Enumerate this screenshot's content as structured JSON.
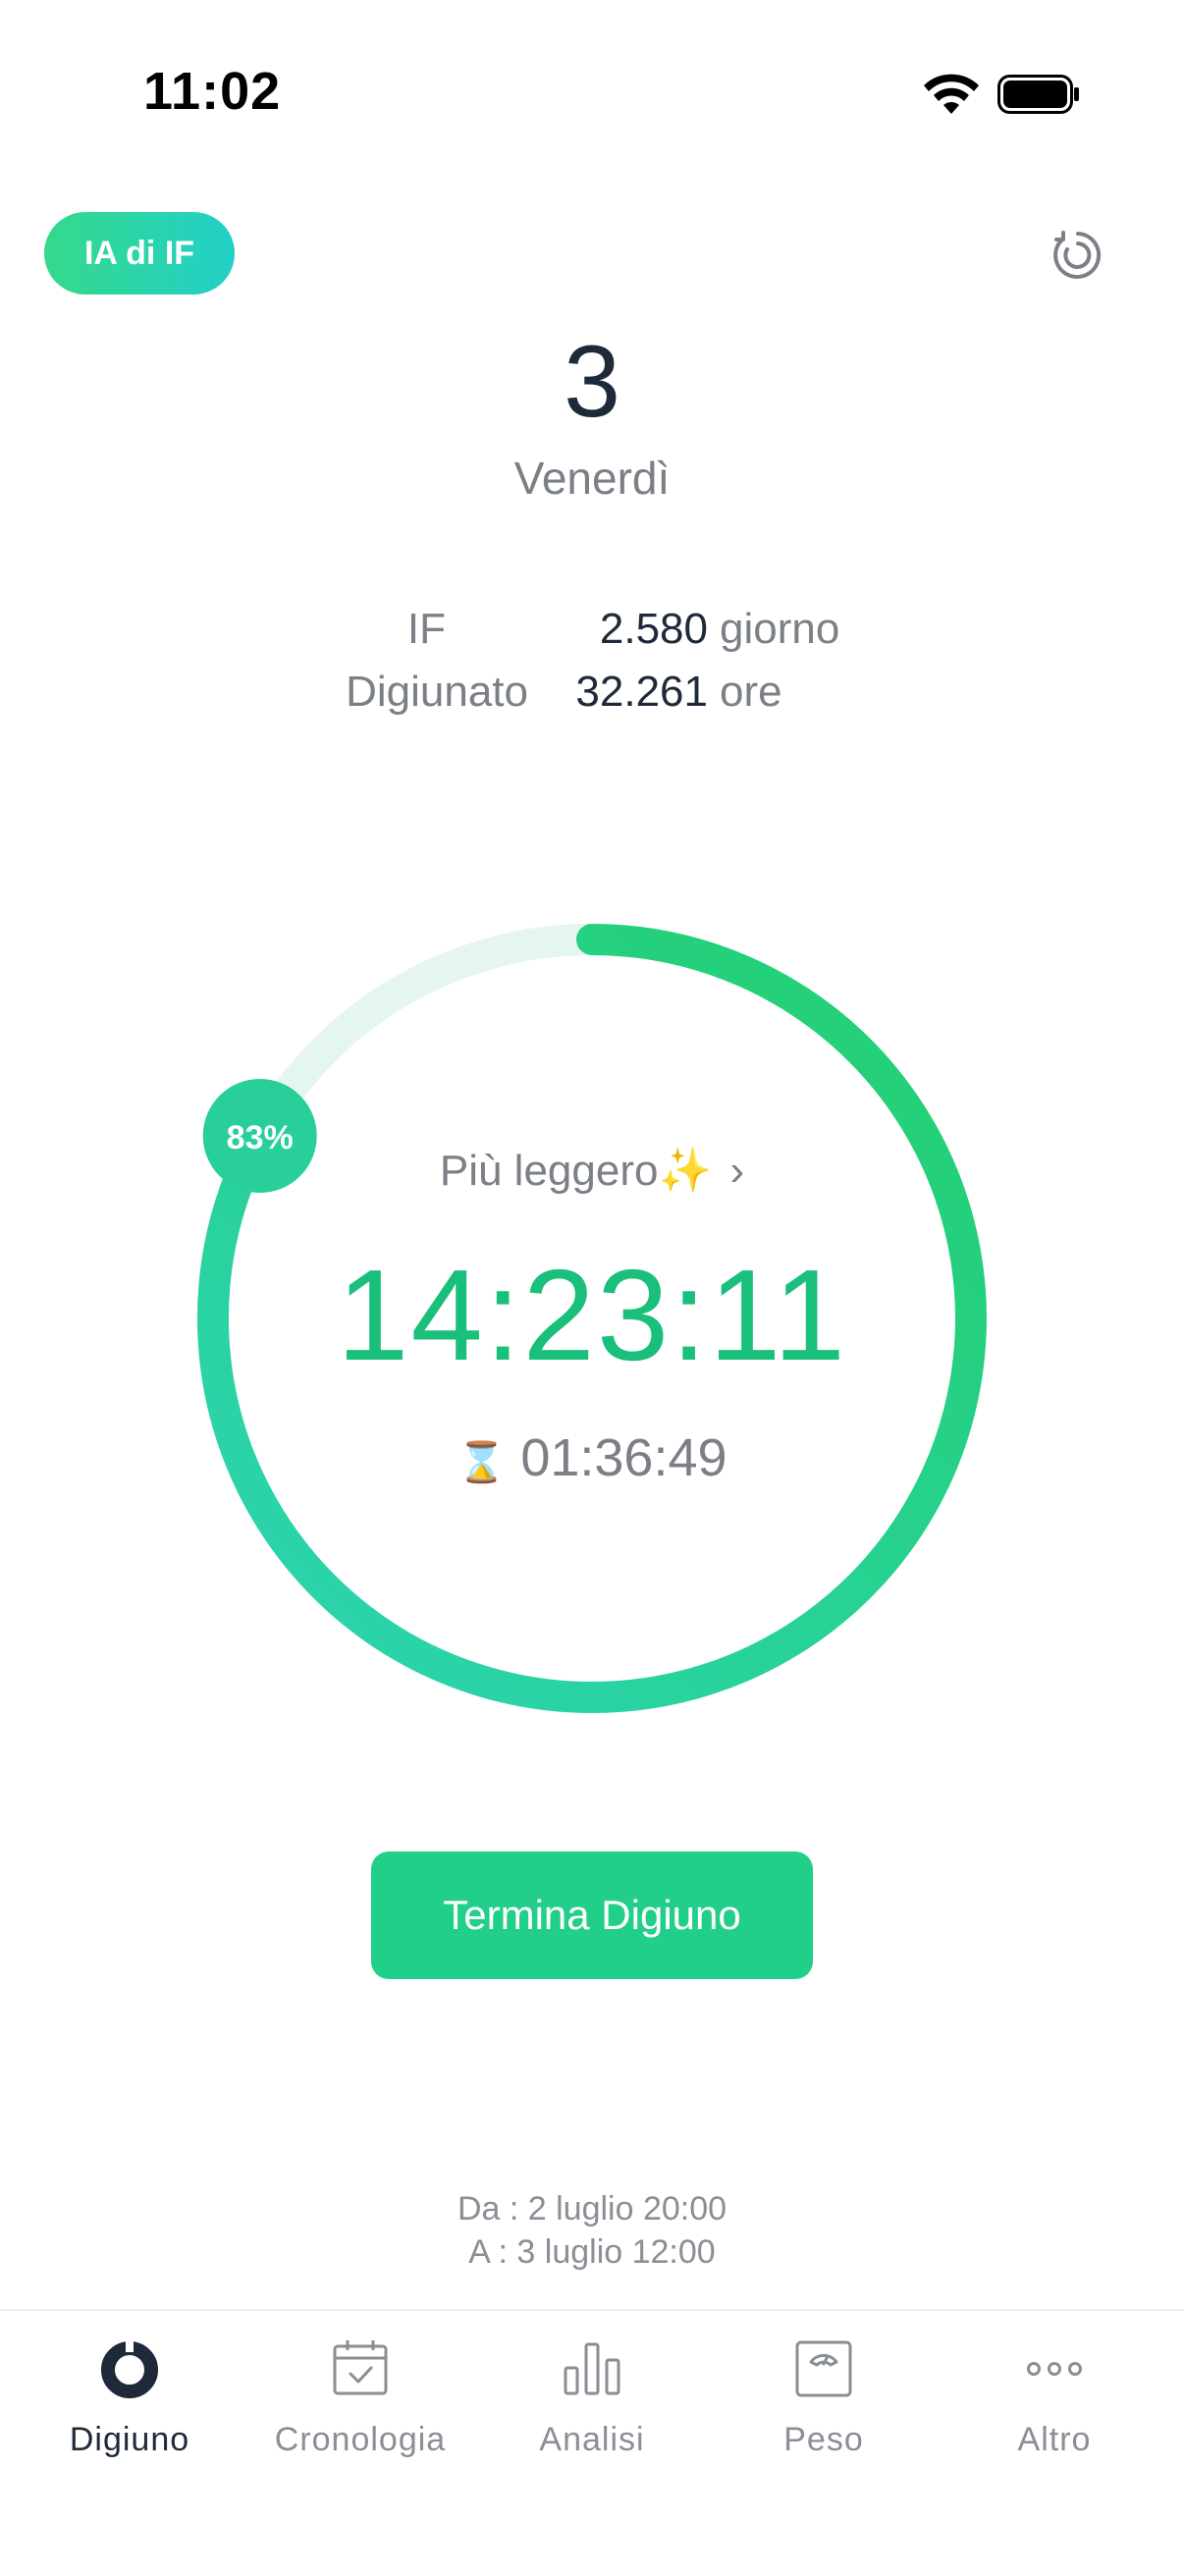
{
  "status": {
    "time": "11:02"
  },
  "header": {
    "ai_label": "IA di IF"
  },
  "day": {
    "number": "3",
    "name": "Venerdì"
  },
  "stats": [
    {
      "label": "IF",
      "value": "2.580",
      "unit": "giorno"
    },
    {
      "label": "Digiunato",
      "value": "32.261",
      "unit": "ore"
    }
  ],
  "progress": {
    "percent": 83,
    "label": "83%"
  },
  "phase": {
    "label": "Più leggero✨",
    "chevron": "›"
  },
  "timer": {
    "elapsed": "14:23:11",
    "remaining": "01:36:49",
    "remaining_icon": "⌛"
  },
  "action": {
    "end_label": "Termina Digiuno"
  },
  "range": {
    "from": "Da : 2 luglio 20:00",
    "to": "A : 3 luglio 12:00"
  },
  "tabs": [
    {
      "label": "Digiuno",
      "icon": "fasting-ring-icon",
      "active": true
    },
    {
      "label": "Cronologia",
      "icon": "calendar-check-icon",
      "active": false
    },
    {
      "label": "Analisi",
      "icon": "bar-chart-icon",
      "active": false
    },
    {
      "label": "Peso",
      "icon": "scale-icon",
      "active": false
    },
    {
      "label": "Altro",
      "icon": "more-dots-icon",
      "active": false
    }
  ],
  "colors": {
    "accent": "#22cf8a",
    "accent_teal": "#2dd4b4",
    "track": "#e5f6ee",
    "text_dark": "#1e2a3a",
    "text_muted": "#7b7f86"
  }
}
